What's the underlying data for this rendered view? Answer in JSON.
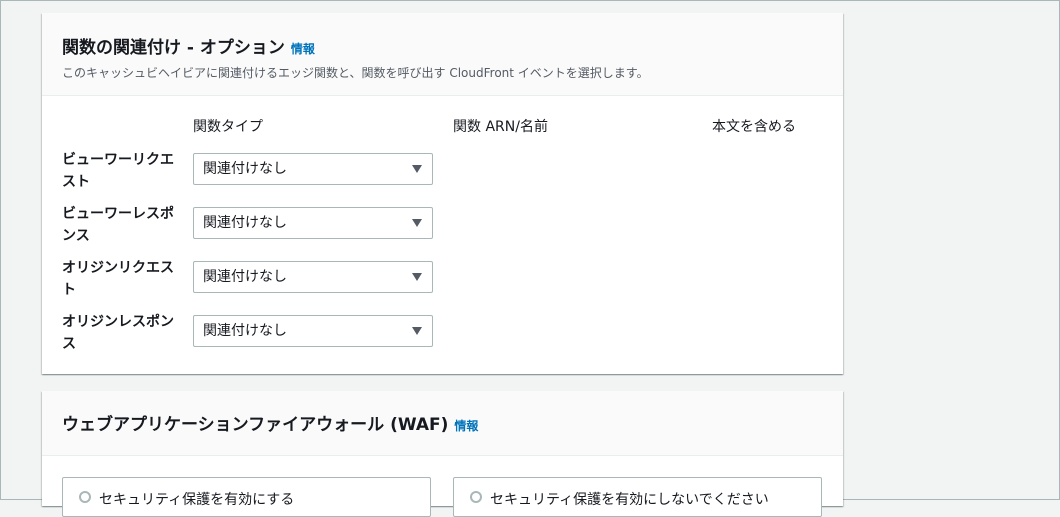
{
  "function_panel": {
    "title": "関数の関連付け - オプション",
    "info": "情報",
    "description": "このキャッシュビヘイビアに関連付けるエッジ関数と、関数を呼び出す CloudFront イベントを選択します。",
    "columns": {
      "type": "関数タイプ",
      "arn": "関数 ARN/名前",
      "body": "本文を含める"
    },
    "rows": [
      {
        "label": "ビューワーリクエスト",
        "select": "関連付けなし"
      },
      {
        "label": "ビューワーレスポンス",
        "select": "関連付けなし"
      },
      {
        "label": "オリジンリクエスト",
        "select": "関連付けなし"
      },
      {
        "label": "オリジンレスポンス",
        "select": "関連付けなし"
      }
    ]
  },
  "waf_panel": {
    "title": "ウェブアプリケーションファイアウォール (WAF)",
    "info": "情報",
    "options": [
      {
        "label": "セキュリティ保護を有効にする"
      },
      {
        "label": "セキュリティ保護を有効にしないでください"
      }
    ]
  }
}
